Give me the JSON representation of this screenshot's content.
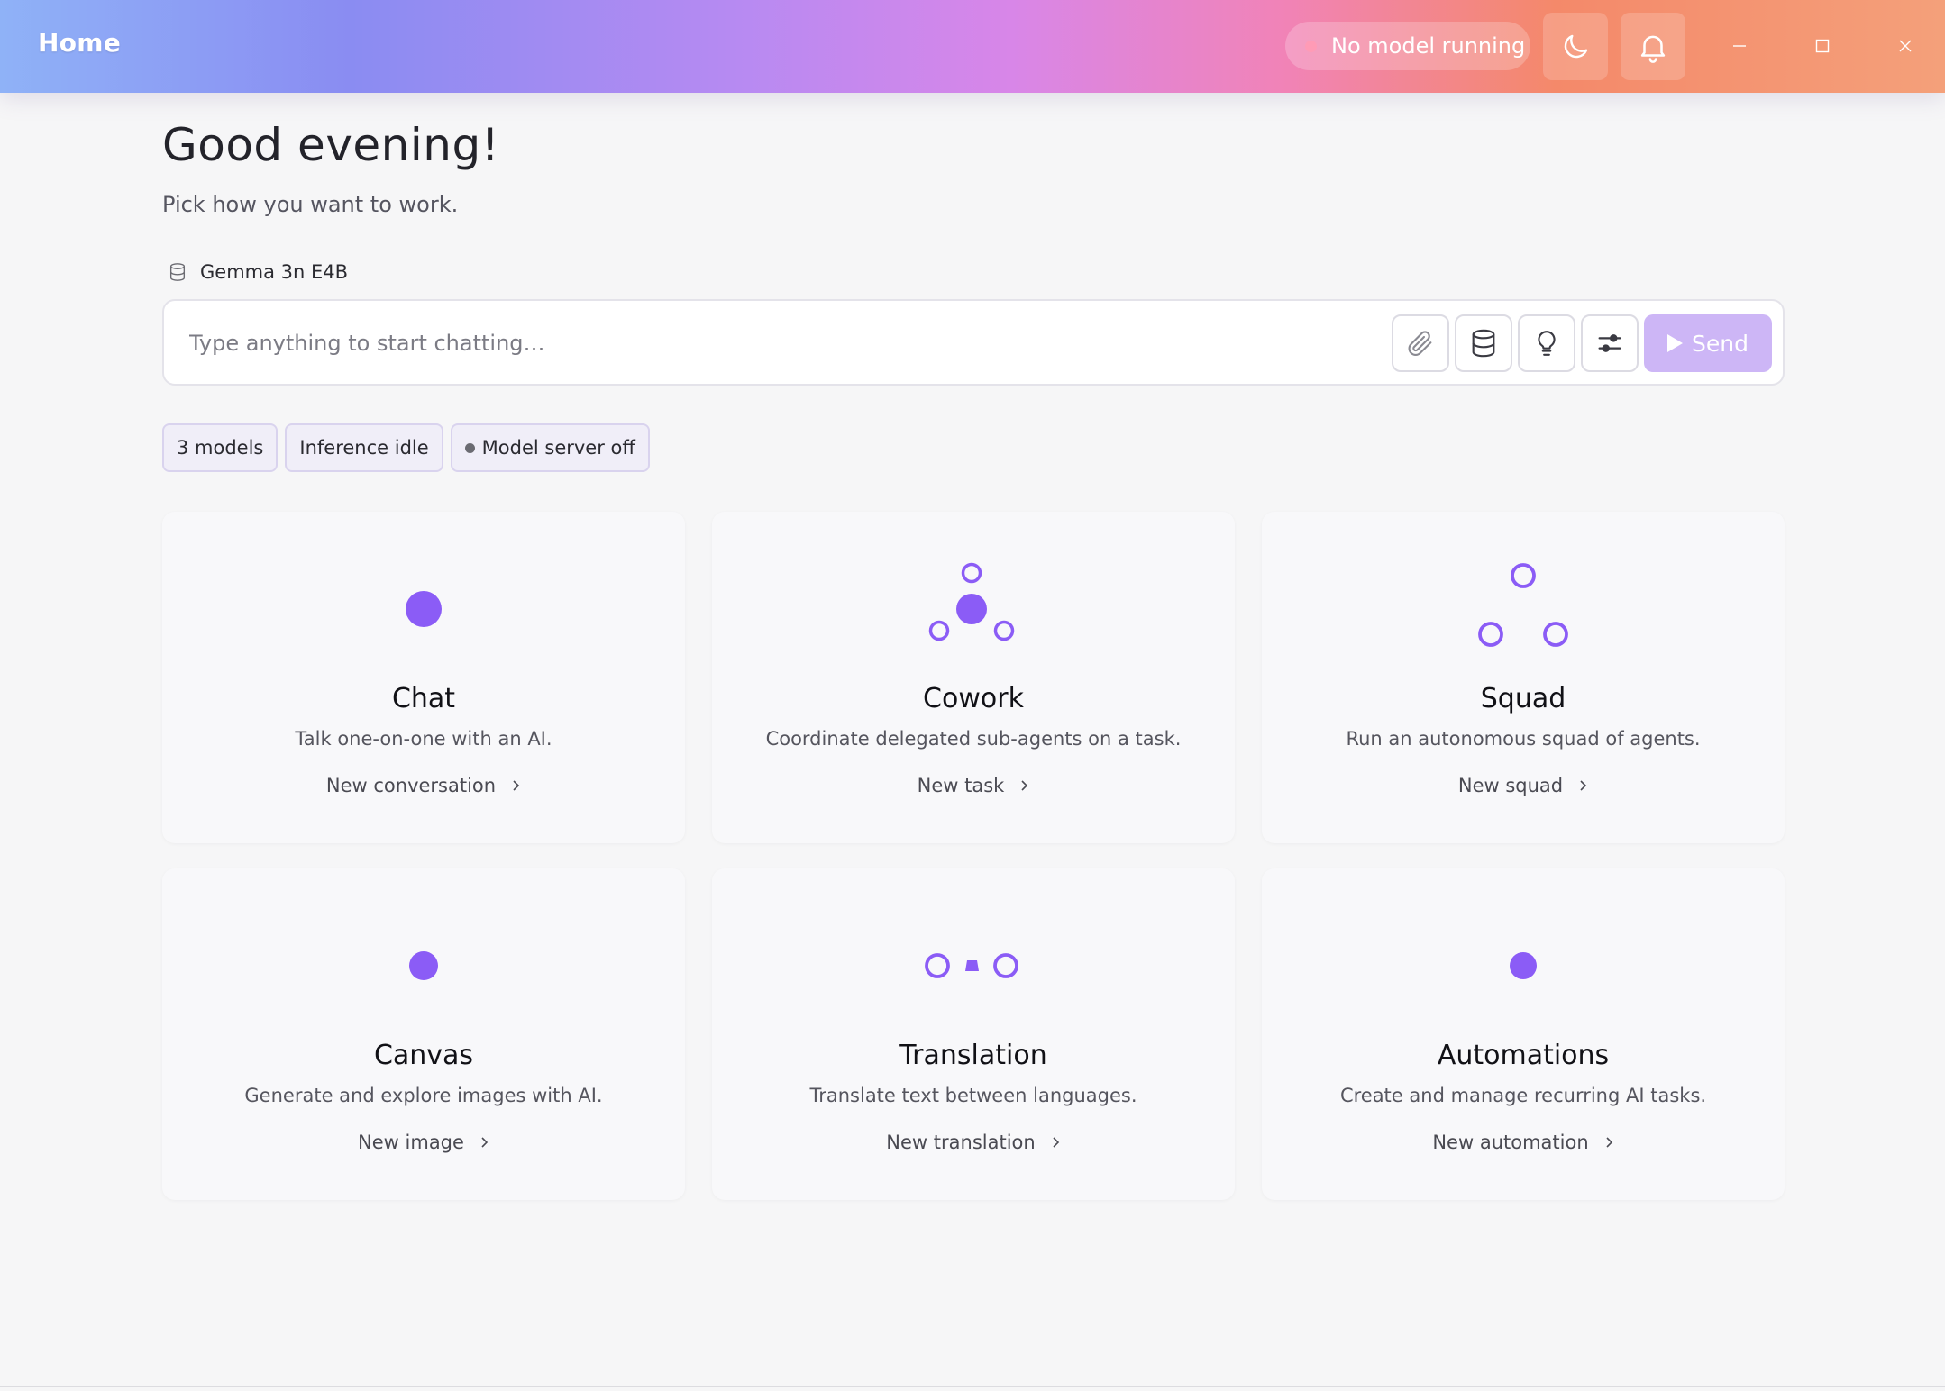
{
  "window": {
    "title": "Home",
    "status_text": "No model running",
    "icons": [
      "moon-icon",
      "bell-icon",
      "minimize-icon",
      "maximize-icon",
      "close-icon"
    ]
  },
  "home": {
    "greeting": "Good evening!",
    "subtitle": "Pick how you want to work."
  },
  "model_selector": {
    "label": "Gemma 3n E4B",
    "icon": "database-icon"
  },
  "chat": {
    "placeholder": "Type anything to start chatting…",
    "value": "",
    "tools": [
      "paperclip-icon",
      "database-icon",
      "lightbulb-icon",
      "sliders-icon"
    ],
    "send_label": "Send"
  },
  "chips": [
    {
      "label": "3 models"
    },
    {
      "label": "Inference idle"
    },
    {
      "label": "Model server off"
    }
  ],
  "cards": [
    {
      "title": "Chat",
      "description": "Talk one-on-one with an AI.",
      "action": "New conversation",
      "icon": "single-dot-icon"
    },
    {
      "title": "Cowork",
      "description": "Coordinate delegated sub-agents on a task.",
      "action": "New task",
      "icon": "hub-nodes-icon"
    },
    {
      "title": "Squad",
      "description": "Run an autonomous squad of agents.",
      "action": "New squad",
      "icon": "triangle-nodes-icon"
    },
    {
      "title": "Canvas",
      "description": "Generate and explore images with AI.",
      "action": "New image",
      "icon": "single-dot-icon"
    },
    {
      "title": "Translation",
      "description": "Translate text between languages.",
      "action": "New translation",
      "icon": "translate-nodes-icon"
    },
    {
      "title": "Automations",
      "description": "Create and manage recurring AI tasks.",
      "action": "New automation",
      "icon": "single-dot-icon"
    }
  ],
  "colors": {
    "accent": "#8b5cf6",
    "send_disabled": "#cdb6f6",
    "chip_bg": "#f0eef8"
  }
}
